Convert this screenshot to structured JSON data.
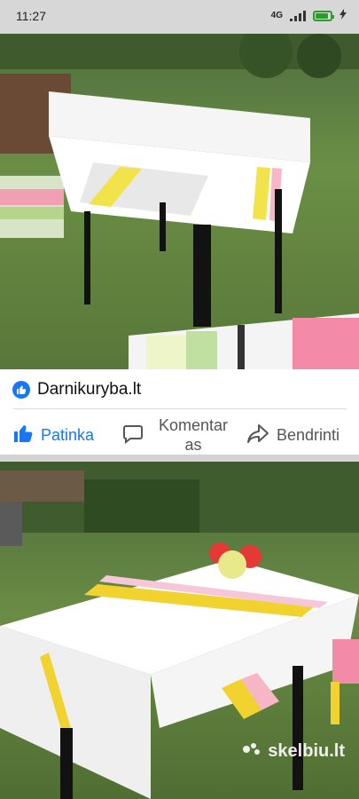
{
  "status_bar": {
    "time": "11:27",
    "network": "4G",
    "battery_level": 0.9,
    "battery_color": "#2e9b2e"
  },
  "post": {
    "page_name": "Darnikuryba.lt",
    "verified_icon": "thumbs-up-icon",
    "actions": {
      "like": "Patinka",
      "comment": "Komentar as",
      "share": "Bendrinti"
    },
    "accent_color": "#1877f2"
  },
  "images": {
    "watermark": "skelbiu.lt"
  }
}
